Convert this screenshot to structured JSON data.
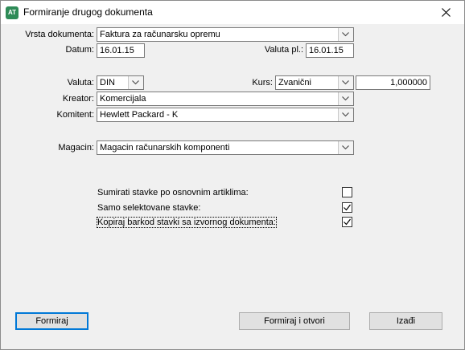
{
  "window": {
    "title": "Formiranje drugog dokumenta",
    "app_icon_text": "AT"
  },
  "form": {
    "vrsta_dokumenta": {
      "label": "Vrsta dokumenta:",
      "value": "Faktura za računarsku opremu"
    },
    "datum": {
      "label": "Datum:",
      "value": "16.01.15"
    },
    "valuta_pl": {
      "label": "Valuta pl.:",
      "value": "16.01.15"
    },
    "valuta": {
      "label": "Valuta:",
      "value": "DIN"
    },
    "kurs": {
      "label": "Kurs:",
      "value": "Zvanični",
      "amount": "1,000000"
    },
    "kreator": {
      "label": "Kreator:",
      "value": "Komercijala"
    },
    "komitent": {
      "label": "Komitent:",
      "value": "Hewlett Packard - K"
    },
    "magacin": {
      "label": "Magacin:",
      "value": "Magacin računarskih komponenti"
    }
  },
  "options": [
    {
      "label": "Sumirati stavke po osnovnim artiklima:",
      "checked": false
    },
    {
      "label": "Samo selektovane stavke:",
      "checked": true
    },
    {
      "label": "Kopiraj barkod stavki sa izvornog dokumenta:",
      "checked": true
    }
  ],
  "buttons": {
    "formiraj": "Formiraj",
    "formiraj_otvori": "Formiraj i otvori",
    "izadi": "Izađi"
  },
  "colors": {
    "accent": "#0078d7",
    "window_bg": "#f0f0f0",
    "app_icon": "#2e8b57"
  }
}
